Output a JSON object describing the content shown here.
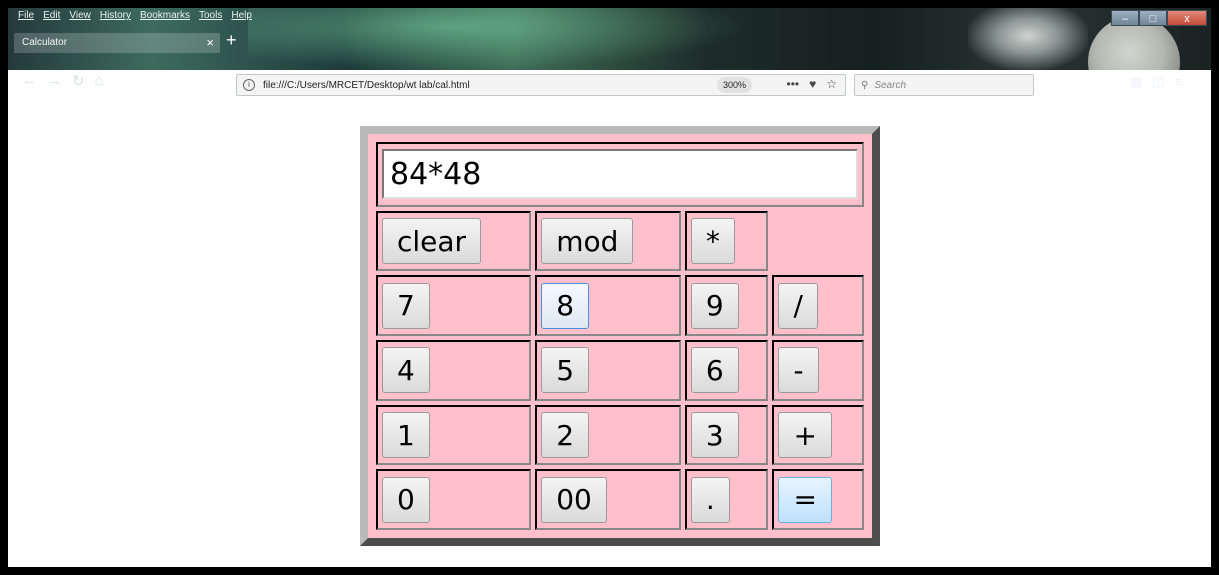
{
  "browser": {
    "menu": [
      "File",
      "Edit",
      "View",
      "History",
      "Bookmarks",
      "Tools",
      "Help"
    ],
    "tab_title": "Calculator",
    "tab_close": "×",
    "new_tab": "+",
    "url": "file:///C:/Users/MRCET/Desktop/wt lab/cal.html",
    "zoom": "300%",
    "search_placeholder": "Search",
    "page_actions_more": "•••",
    "info_glyph": "i",
    "back_glyph": "←",
    "forward_glyph": "→",
    "reload_glyph": "↻",
    "home_glyph": "⌂",
    "pocket_glyph": "♥",
    "star_glyph": "☆",
    "search_glyph": "⚲",
    "library_glyph": "▥",
    "sidebar_glyph": "◫",
    "menu_glyph": "≡",
    "minimize_glyph": "–",
    "maximize_glyph": "□",
    "close_glyph": "x"
  },
  "calculator": {
    "display_value": "84*48",
    "buttons": {
      "clear": "clear",
      "mod": "mod",
      "multiply": "*",
      "seven": "7",
      "eight": "8",
      "nine": "9",
      "divide": "/",
      "four": "4",
      "five": "5",
      "six": "6",
      "minus": "-",
      "one": "1",
      "two": "2",
      "three": "3",
      "plus": "+",
      "zero": "0",
      "double_zero": "00",
      "dot": ".",
      "equals": "="
    }
  }
}
